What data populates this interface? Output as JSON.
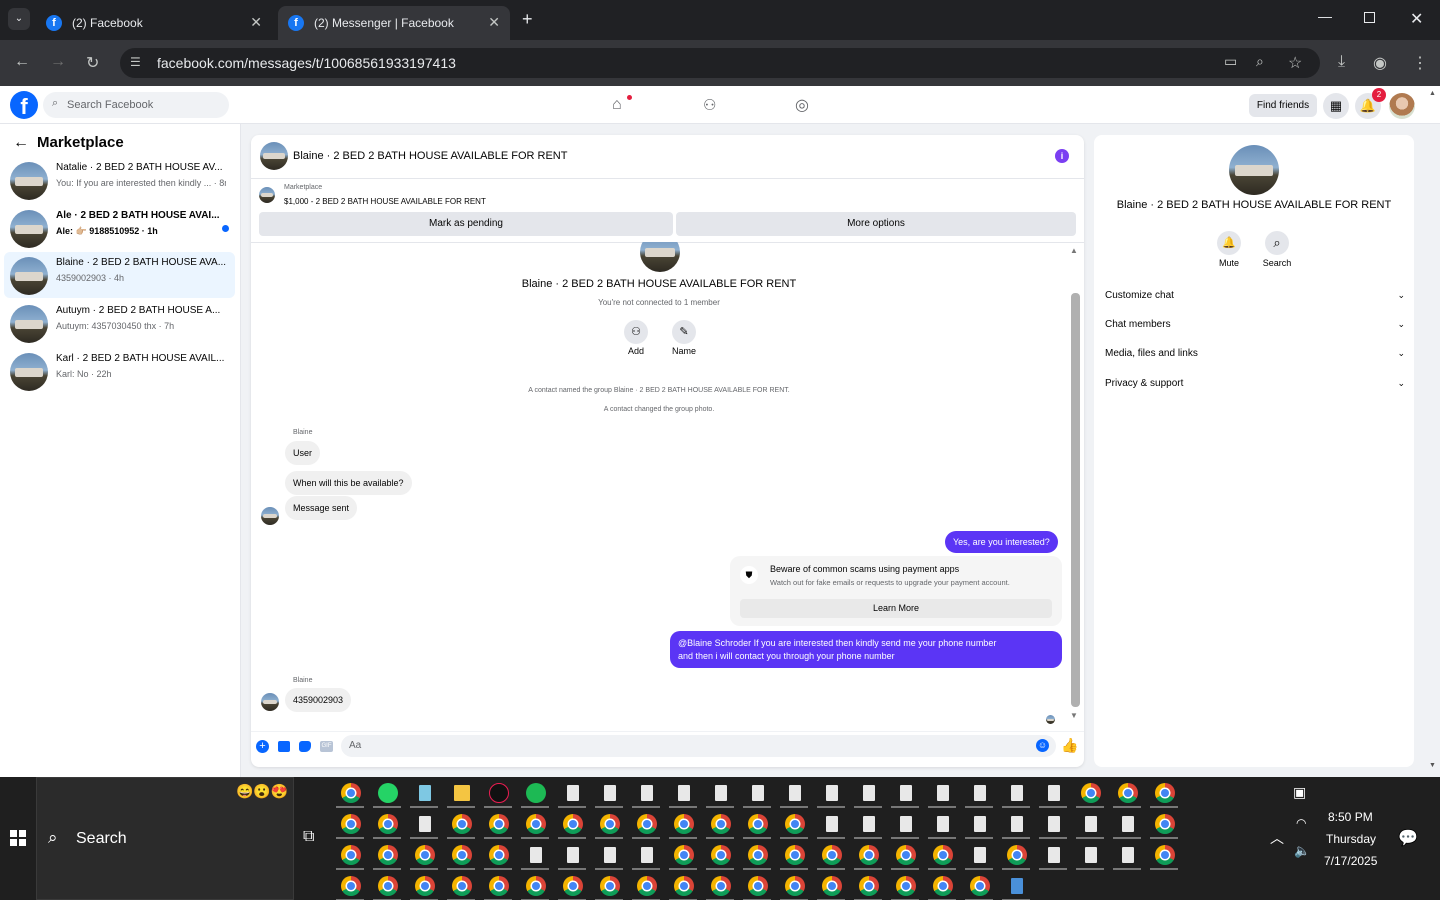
{
  "browser": {
    "tabs": [
      {
        "title": "(2) Facebook",
        "active": false
      },
      {
        "title": "(2) Messenger | Facebook",
        "active": true
      }
    ],
    "url": "facebook.com/messages/t/10068561933197413"
  },
  "fb_header": {
    "search_placeholder": "Search Facebook",
    "find_friends": "Find friends",
    "notification_count": "2"
  },
  "sidebar": {
    "title": "Marketplace",
    "conversations": [
      {
        "name": "Natalie · 2 BED 2 BATH HOUSE AV...",
        "preview": "You: If you are interested then kindly ... · 8m",
        "active": false,
        "unread": false
      },
      {
        "name": "Ale · 2 BED 2 BATH HOUSE AVAI...",
        "preview": "Ale: 👉🏼 9188510952 · 1h",
        "active": false,
        "unread": true
      },
      {
        "name": "Blaine · 2 BED 2 BATH HOUSE AVA...",
        "preview": "4359002903 · 4h",
        "active": true,
        "unread": false
      },
      {
        "name": "Autuym · 2 BED 2 BATH HOUSE A...",
        "preview": "Autuym: 4357030450 thx · 7h",
        "active": false,
        "unread": false
      },
      {
        "name": "Karl · 2 BED 2 BATH HOUSE AVAIL...",
        "preview": "Karl: No · 22h",
        "active": false,
        "unread": false
      }
    ]
  },
  "chat": {
    "title": "Blaine · 2 BED 2 BATH HOUSE AVAILABLE FOR RENT",
    "listing_source": "Marketplace",
    "listing": "$1,000 - 2 BED 2 BATH HOUSE AVAILABLE FOR RENT",
    "mark_pending": "Mark as pending",
    "more_options": "More options",
    "group_name": "Blaine · 2 BED 2 BATH HOUSE AVAILABLE FOR RENT",
    "connection_note": "You're not connected to 1 member",
    "add_label": "Add",
    "name_label": "Name",
    "sys1": "A contact named the group Blaine · 2 BED 2 BATH HOUSE AVAILABLE FOR RENT.",
    "sys2": "A contact changed the group photo.",
    "sender1": "Blaine",
    "msg_user": "User",
    "msg_when": "When will this be available?",
    "msg_sent": "Message sent",
    "out1": "Yes, are you interested?",
    "warn_title": "Beware of common scams using payment apps",
    "warn_body": "Watch out for fake emails or requests to upgrade your payment account.",
    "learn_more": "Learn More",
    "out2_line1": "@Blaine Schroder If you are interested then kindly send me your phone number",
    "out2_line2": "and then i will contact you through your phone number",
    "sender2": "Blaine",
    "msg_phone": "4359002903",
    "composer_placeholder": "Aa",
    "gif": "GIF"
  },
  "right_panel": {
    "title": "Blaine · 2 BED 2 BATH HOUSE AVAILABLE FOR RENT",
    "mute": "Mute",
    "search": "Search",
    "sections": [
      "Customize chat",
      "Chat members",
      "Media, files and links",
      "Privacy & support"
    ]
  },
  "taskbar": {
    "search": "Search",
    "time": "8:50 PM",
    "day": "Thursday",
    "date": "7/17/2025"
  },
  "colors": {
    "accent": "#5b35f5",
    "fb_blue": "#0866ff",
    "unread_dot": "#0866ff"
  }
}
